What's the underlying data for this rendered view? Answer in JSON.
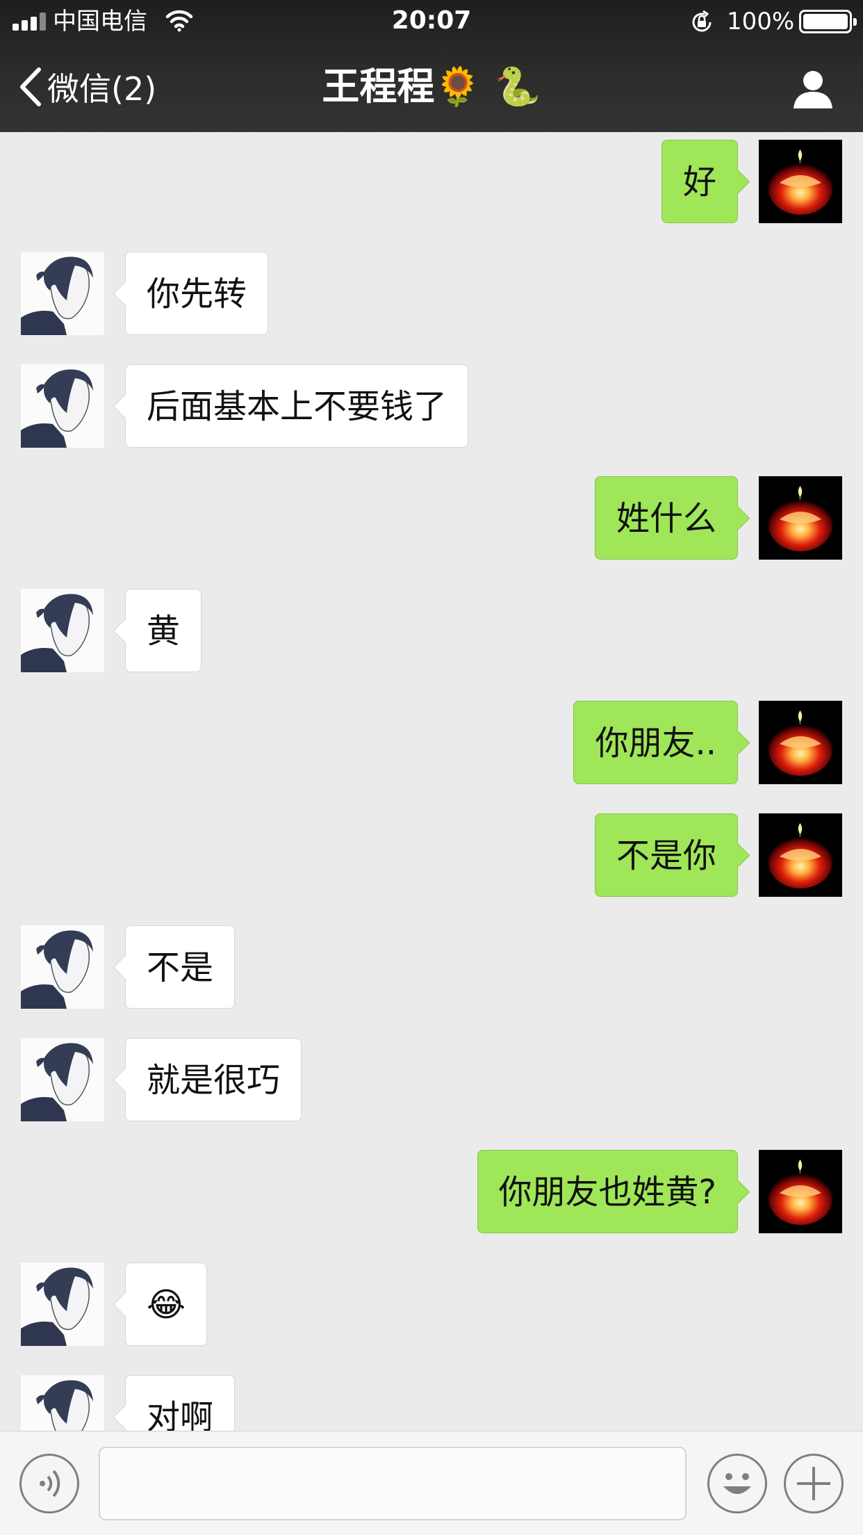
{
  "status_bar": {
    "carrier": "中国电信",
    "time": "20:07",
    "battery_percent": "100%",
    "signal_icon": "signal-bars-icon",
    "wifi_icon": "wifi-icon",
    "orientation_lock_icon": "orientation-lock-icon",
    "battery_icon": "battery-icon",
    "battery_level": 1.0
  },
  "nav": {
    "back_label": "微信(2)",
    "back_icon": "chevron-left-icon",
    "title": "王程程🌻 🐍",
    "profile_icon": "person-icon"
  },
  "colors": {
    "header_bg": "#2a2d2a",
    "chat_bg": "#ebebeb",
    "sent_bubble": "#9fe658",
    "received_bubble": "#ffffff"
  },
  "messages": [
    {
      "side": "right",
      "text": "好"
    },
    {
      "side": "left",
      "text": "你先转"
    },
    {
      "side": "left",
      "text": "后面基本上不要钱了"
    },
    {
      "side": "right",
      "text": "姓什么"
    },
    {
      "side": "left",
      "text": "黄"
    },
    {
      "side": "right",
      "text": "你朋友.."
    },
    {
      "side": "right",
      "text": "不是你"
    },
    {
      "side": "left",
      "text": "不是"
    },
    {
      "side": "left",
      "text": "就是很巧"
    },
    {
      "side": "right",
      "text": "你朋友也姓黄?"
    },
    {
      "side": "left",
      "text": "😂"
    },
    {
      "side": "left",
      "text": "对啊"
    }
  ],
  "input_bar": {
    "voice_icon": "voice-icon",
    "text_value": "",
    "emoji_icon": "emoji-smiley-icon",
    "plus_icon": "plus-icon"
  }
}
